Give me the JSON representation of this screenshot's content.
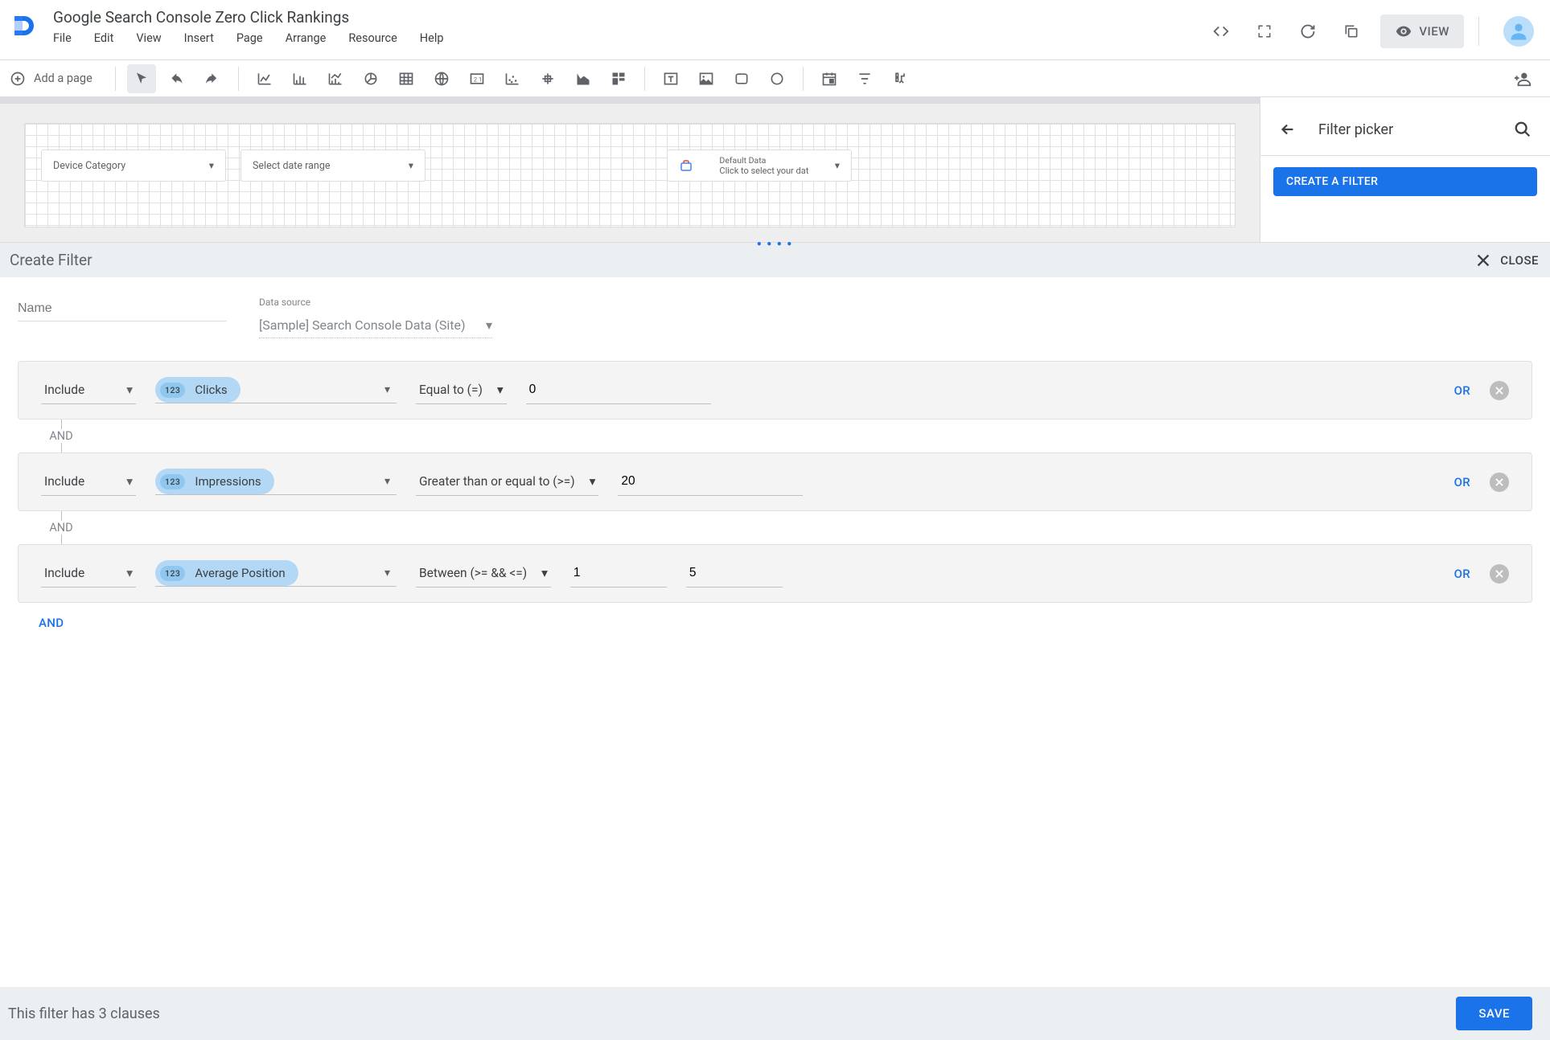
{
  "header": {
    "title": "Google Search Console Zero Click Rankings",
    "menus": [
      "File",
      "Edit",
      "View",
      "Insert",
      "Page",
      "Arrange",
      "Resource",
      "Help"
    ],
    "view_label": "VIEW"
  },
  "toolbar": {
    "add_page": "Add a page"
  },
  "canvas": {
    "controls": {
      "device": "Device Category",
      "date": "Select date range",
      "data_label": "Default Data",
      "data_sub": "Click to select your dat"
    }
  },
  "right_panel": {
    "title": "Filter picker",
    "create_btn": "CREATE A FILTER"
  },
  "sheet": {
    "title": "Create Filter",
    "close": "CLOSE",
    "name_label": "Name",
    "ds_label": "Data source",
    "ds_value": "[Sample] Search Console Data (Site)"
  },
  "clauses": [
    {
      "mode": "Include",
      "type_tag": "123",
      "metric": "Clicks",
      "operator": "Equal to (=)",
      "values": [
        "0"
      ]
    },
    {
      "mode": "Include",
      "type_tag": "123",
      "metric": "Impressions",
      "operator": "Greater than or equal to (>=)",
      "values": [
        "20"
      ]
    },
    {
      "mode": "Include",
      "type_tag": "123",
      "metric": "Average Position",
      "operator": "Between (>= && <=)",
      "values": [
        "1",
        "5"
      ]
    }
  ],
  "labels": {
    "and": "AND",
    "or": "OR",
    "save": "SAVE"
  },
  "footer": {
    "status": "This filter has 3 clauses"
  }
}
